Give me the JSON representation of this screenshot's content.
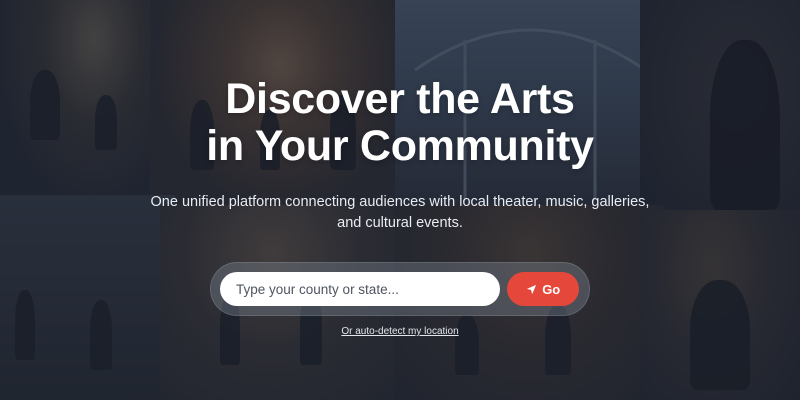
{
  "hero": {
    "title_line1": "Discover the Arts",
    "title_line2": "in Your Community",
    "subtitle": "One unified platform connecting audiences with local theater, music, galleries, and cultural events."
  },
  "search": {
    "placeholder": "Type your county or state...",
    "value": "",
    "go_label": "Go",
    "go_icon": "navigation-arrow-icon"
  },
  "auto_detect": {
    "label": "Or auto-detect my location"
  },
  "colors": {
    "accent": "#e5483b",
    "overlay": "#1a212e",
    "text": "#ffffff"
  }
}
